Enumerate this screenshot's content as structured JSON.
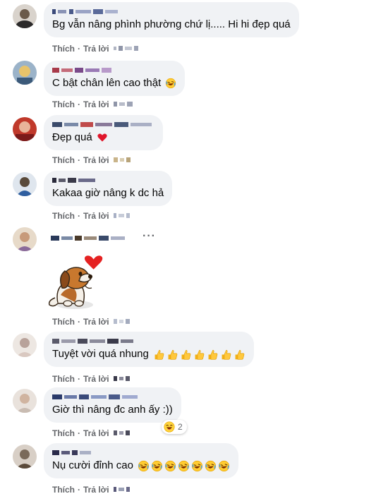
{
  "actions": {
    "like": "Thích",
    "reply": "Trả lời",
    "separator": "·"
  },
  "colors": {
    "bubble": "#f0f2f5",
    "meta": "#65676b",
    "text": "#050505"
  },
  "comments": [
    {
      "text": "Bg vẫn nâng phình phường chứ lị..... Hi hi đẹp quá",
      "emojis": []
    },
    {
      "text": "C bật chân lên cao thật",
      "emojis": [
        "rofl-emoji"
      ]
    },
    {
      "text": "Đẹp quá",
      "emojis": [
        "red-heart-emoji"
      ]
    },
    {
      "text": "Kakaa giờ nâng k dc hả",
      "emojis": []
    },
    {
      "text": "",
      "sticker": "puppy-heart-sticker",
      "more": "···"
    },
    {
      "text": "Tuyệt vời quá nhung",
      "emojis": [
        "thumbs-up-emoji",
        "thumbs-up-emoji",
        "thumbs-up-emoji",
        "thumbs-up-emoji",
        "thumbs-up-emoji",
        "thumbs-up-emoji",
        "thumbs-up-emoji"
      ]
    },
    {
      "text": "Giờ thì nâng đc anh ấy :))",
      "emojis": [],
      "reaction": {
        "icon": "laughing-emoji",
        "count": "2"
      }
    },
    {
      "text": "Nụ cười đỉnh cao",
      "emojis": [
        "rofl-emoji",
        "rofl-emoji",
        "rofl-emoji",
        "rofl-emoji",
        "rofl-emoji",
        "rofl-emoji",
        "rofl-emoji"
      ]
    }
  ]
}
